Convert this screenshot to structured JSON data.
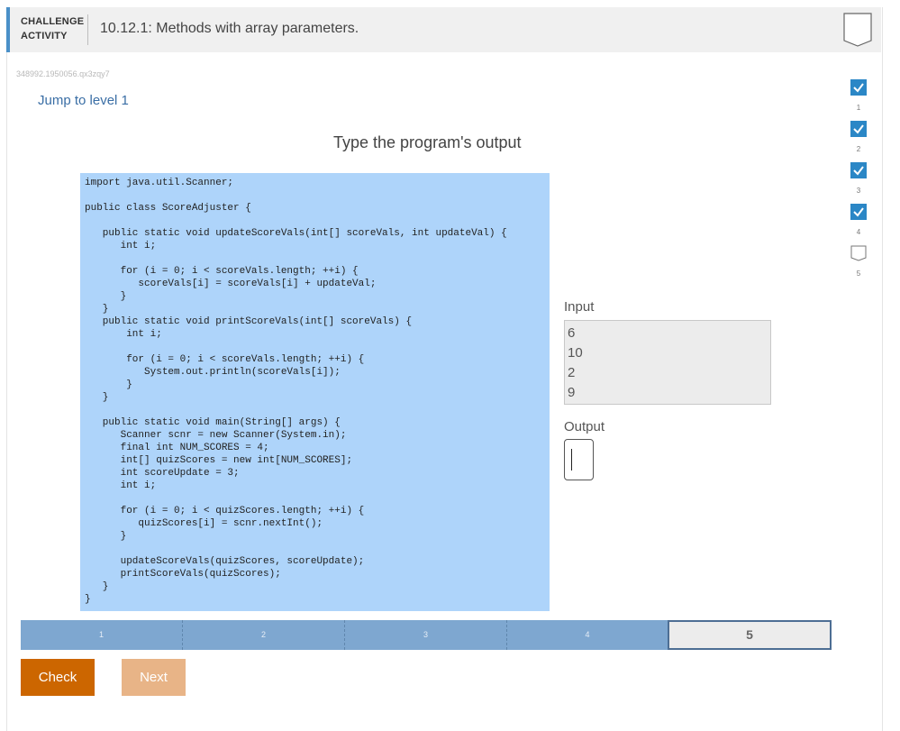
{
  "header": {
    "badge_line1": "CHALLENGE",
    "badge_line2": "ACTIVITY",
    "title": "10.12.1: Methods with array parameters."
  },
  "activity_id": "348992.1950056.qx3zqy7",
  "jump_link": "Jump to level 1",
  "instruction": "Type the program's output",
  "code": [
    "import java.util.Scanner;",
    "",
    "public class ScoreAdjuster {",
    "",
    "   public static void updateScoreVals(int[] scoreVals, int updateVal) {",
    "      int i;",
    "",
    "      for (i = 0; i < scoreVals.length; ++i) {",
    "         scoreVals[i] = scoreVals[i] + updateVal;",
    "      }",
    "   }",
    "   public static void printScoreVals(int[] scoreVals) {",
    "       int i;",
    "",
    "       for (i = 0; i < scoreVals.length; ++i) {",
    "          System.out.println(scoreVals[i]);",
    "       }",
    "   }",
    "",
    "   public static void main(String[] args) {",
    "      Scanner scnr = new Scanner(System.in);",
    "      final int NUM_SCORES = 4;",
    "      int[] quizScores = new int[NUM_SCORES];",
    "      int scoreUpdate = 3;",
    "      int i;",
    "",
    "      for (i = 0; i < quizScores.length; ++i) {",
    "         quizScores[i] = scnr.nextInt();",
    "      }",
    "",
    "      updateScoreVals(quizScores, scoreUpdate);",
    "      printScoreVals(quizScores);",
    "   }",
    "}"
  ],
  "input": {
    "label": "Input",
    "values": [
      "6",
      "10",
      "2",
      "9"
    ]
  },
  "output": {
    "label": "Output",
    "value": ""
  },
  "levels": [
    {
      "num": "1",
      "done": true
    },
    {
      "num": "2",
      "done": true
    },
    {
      "num": "3",
      "done": true
    },
    {
      "num": "4",
      "done": true
    },
    {
      "num": "5",
      "done": false
    }
  ],
  "progress": [
    "1",
    "2",
    "3",
    "4",
    "5"
  ],
  "buttons": {
    "check": "Check",
    "next": "Next"
  },
  "colors": {
    "accent": "#4a90c8",
    "code_bg": "#aed4fa",
    "check": "#cc6600",
    "next": "#e8b487",
    "progress": "#7ea7d0",
    "level_done": "#2b87c6"
  }
}
